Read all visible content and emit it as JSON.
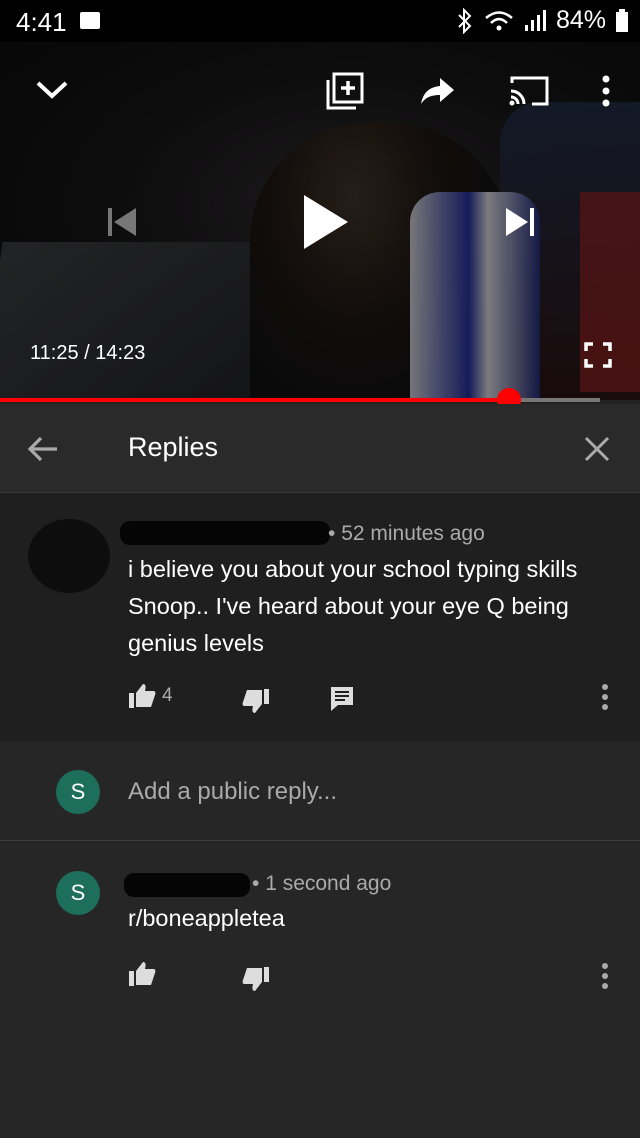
{
  "status_bar": {
    "time": "4:41",
    "battery": "84%"
  },
  "video": {
    "time_current": "11:25",
    "time_total": "14:23",
    "time_sep": "/",
    "progress": 0.848
  },
  "replies_header": {
    "title": "Replies"
  },
  "parent_comment": {
    "meta": "52 minutes ago",
    "text": "i believe you about your school typing skills Snoop.. I've heard about your eye Q being genius levels",
    "likes": "4"
  },
  "reply_box": {
    "avatar_letter": "S",
    "placeholder": "Add a public reply..."
  },
  "my_reply": {
    "avatar_letter": "S",
    "meta": "1 second ago",
    "text": "r/boneappletea"
  },
  "colors": {
    "accent": "#ff0000",
    "avatar_bg": "#1e6e5c"
  }
}
